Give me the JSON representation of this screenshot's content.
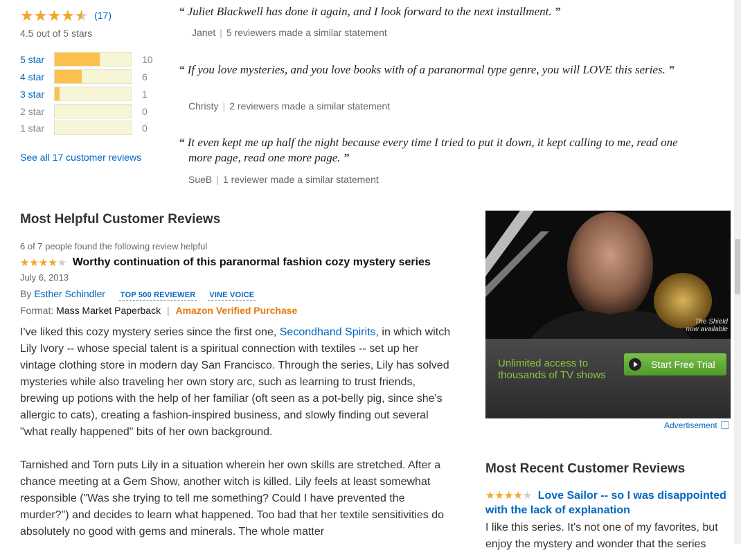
{
  "summary": {
    "rating": 4.5,
    "review_count": "(17)",
    "rating_text": "4.5 out of 5 stars",
    "see_all": "See all 17 customer reviews",
    "histogram": [
      {
        "label": "5 star",
        "count": "10",
        "fraction": 0.59
      },
      {
        "label": "4 star",
        "count": "6",
        "fraction": 0.35
      },
      {
        "label": "3 star",
        "count": "1",
        "fraction": 0.06
      },
      {
        "label": "2 star",
        "count": "0",
        "fraction": 0
      },
      {
        "label": "1 star",
        "count": "0",
        "fraction": 0
      }
    ]
  },
  "quotes": [
    {
      "text": "Juliet Blackwell has done it again, and I look forward to the next installment.",
      "author": "Janet",
      "note": "5 reviewers made a similar statement"
    },
    {
      "text": "If you love mysteries, and you love books with of a paranormal type genre, you will LOVE this series.",
      "author": "Christy",
      "note": "2 reviewers made a similar statement"
    },
    {
      "text": "It even kept me up half the night because every time I tried to put it down, it kept calling to me, read one more page, read one more page.",
      "author": "SueB",
      "note": "1 reviewer made a similar statement"
    }
  ],
  "helpful": {
    "heading": "Most Helpful Customer Reviews",
    "helpful_count": "6 of 7 people found the following review helpful",
    "rating": 4,
    "title": "Worthy continuation of this paranormal fashion cozy mystery series",
    "date": "July 6, 2013",
    "by": "By",
    "author": "Esther Schindler",
    "badge1": "TOP 500 REVIEWER",
    "badge2": "VINE VOICE",
    "format_label": "Format:",
    "format": "Mass Market Paperback",
    "verified": "Amazon Verified Purchase",
    "p1_a": "I've liked this cozy mystery series since the first one, ",
    "p1_link": "Secondhand Spirits",
    "p1_b": ", in which witch Lily Ivory -- whose special talent is a spiritual connection with textiles -- set up her vintage clothing store in modern day San Francisco. Through the series, Lily has solved mysteries while also traveling her own story arc, such as learning to trust friends, brewing up potions with the help of her familiar (oft seen as a pot-belly pig, since she's allergic to cats), creating a fashion-inspired business, and slowly finding out several \"what really happened\" bits of her own background.",
    "p2": "Tarnished and Torn puts Lily in a situation wherein her own skills are stretched. After a chance meeting at a Gem Show, another witch is killed. Lily feels at least somewhat responsible (\"Was she trying to tell me something? Could I have prevented the murder?\") and decides to learn what happened. Too bad that her textile sensitivities do absolutely no good with gems and minerals. The whole matter"
  },
  "ad": {
    "show_text_1": "The Shield",
    "show_text_2": "now available",
    "tagline": "Unlimited access to thousands of TV shows",
    "cta": "Start Free Trial",
    "label": "Advertisement"
  },
  "recent": {
    "heading": "Most Recent Customer Reviews",
    "rating": 4,
    "title": "Love Sailor -- so I was disappointed with the lack of explanation",
    "body": "I like this series. It's not one of my favorites, but enjoy the mystery and wonder that the series"
  },
  "colors": {
    "star": "#f5a623",
    "link": "#0066c0",
    "verified": "#e47911",
    "bar_fill": "#fcc04f",
    "bar_bg": "#f6f6d6",
    "cta": "#62a83b"
  }
}
